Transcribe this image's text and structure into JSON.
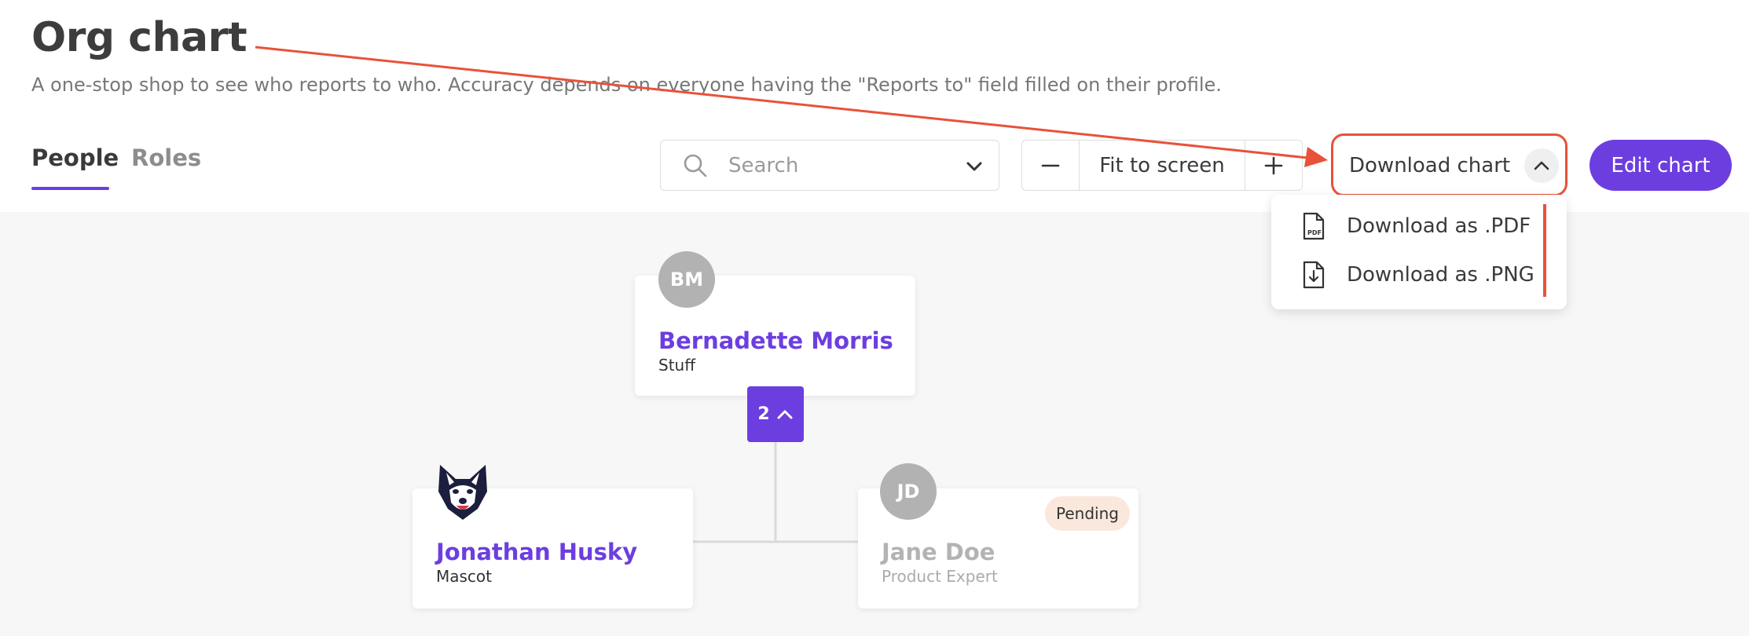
{
  "page": {
    "title": "Org chart",
    "subtitle": "A one-stop shop to see who reports to who. Accuracy depends on everyone having the \"Reports to\" field filled on their profile."
  },
  "tabs": [
    {
      "label": "People",
      "active": true
    },
    {
      "label": "Roles",
      "active": false
    }
  ],
  "toolbar": {
    "search_placeholder": "Search",
    "zoom_label": "Fit to screen",
    "download_label": "Download chart",
    "edit_label": "Edit chart"
  },
  "download_menu": {
    "items": [
      {
        "label": "Download as .PDF",
        "icon": "pdf-file-icon"
      },
      {
        "label": "Download as .PNG",
        "icon": "file-download-icon"
      }
    ]
  },
  "org": {
    "root": {
      "initials": "BM",
      "name": "Bernadette Morris",
      "role": "Stuff",
      "reports_count": "2"
    },
    "reports": [
      {
        "avatar": "husky-mascot-icon",
        "name": "Jonathan Husky",
        "role": "Mascot"
      },
      {
        "initials": "JD",
        "name": "Jane Doe",
        "role": "Product Expert",
        "status": "Pending"
      }
    ]
  },
  "colors": {
    "accent": "#6c3ee0",
    "annotation": "#e8523a",
    "pending_bg": "#fbe8dc"
  }
}
